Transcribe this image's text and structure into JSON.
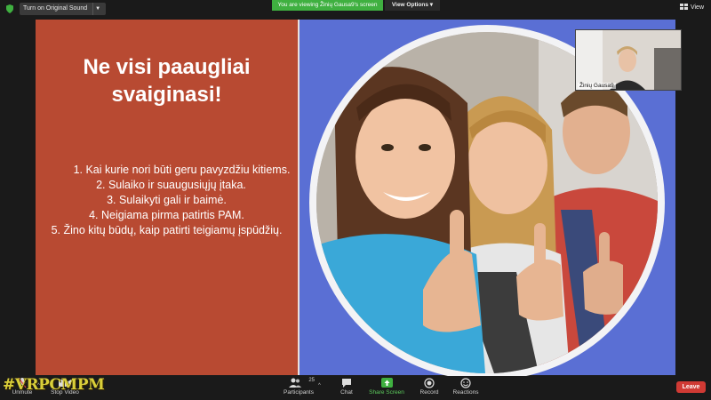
{
  "top_bar": {
    "original_sound_label": "Turn on Original Sound",
    "viewing_banner": "You are viewing Žinių Gausa9's screen",
    "view_options_label": "View Options",
    "view_label": "View"
  },
  "slide": {
    "title": "Ne visi paaugliai svaiginasi!",
    "list_items": [
      "1.   Kai kurie nori būti geru pavyzdžiu kitiems.",
      "2.   Sulaiko ir suaugusiųjų įtaka.",
      "3.   Sulaikyti gali ir baimė.",
      "4.   Neigiama pirma patirtis PAM.",
      "5.   Žino kitų būdų, kaip patirti teigiamų įspūdžių."
    ],
    "colors": {
      "left_panel": "#b84a32",
      "right_panel": "#5a6fd4"
    }
  },
  "participant_thumbnail": {
    "name": "Žinių Gausa9"
  },
  "toolbar": {
    "unmute_label": "Unmute",
    "stop_video_label": "Stop Video",
    "participants_label": "Participants",
    "participants_count": "25",
    "chat_label": "Chat",
    "share_screen_label": "Share Screen",
    "record_label": "Record",
    "reactions_label": "Reactions",
    "leave_label": "Leave"
  },
  "watermark": {
    "text": "#VRPCMPM"
  }
}
